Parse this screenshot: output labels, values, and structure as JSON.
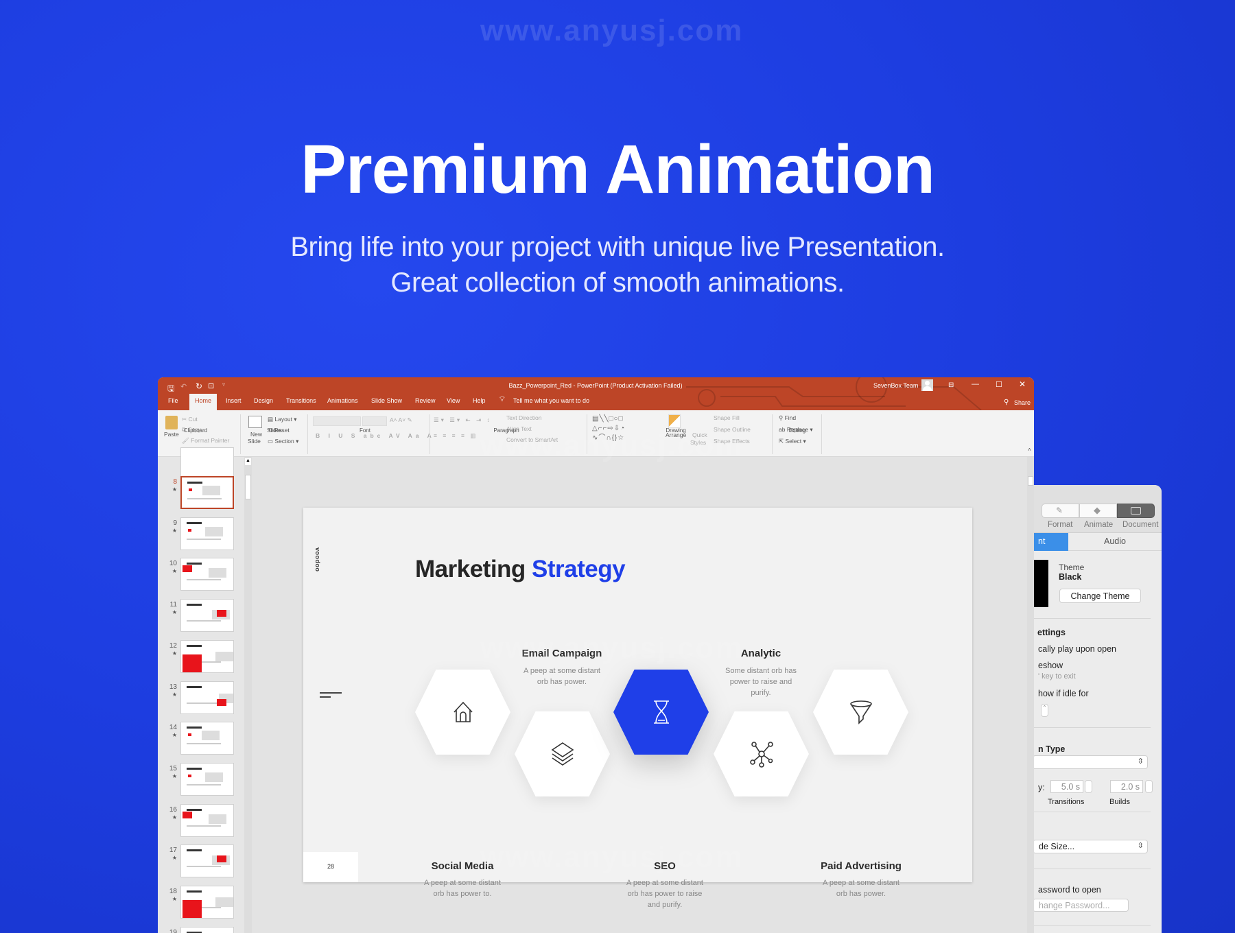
{
  "hero": {
    "title": "Premium Animation",
    "subtitle_line1": "Bring life into your project with unique live Presentation.",
    "subtitle_line2": "Great collection of smooth animations."
  },
  "watermark": "www.anyusj.com",
  "colors": {
    "background": "#1f40e6",
    "titlebar": "#bd4527",
    "accent_blue": "#1f3fe8",
    "thumb_accent": "#e8141b"
  },
  "window": {
    "title": "Bazz_Powerpoint_Red  -  PowerPoint (Product Activation Failed)",
    "user": "SevenBox Team",
    "share": "Share",
    "tabs": [
      "File",
      "Home",
      "Insert",
      "Design",
      "Transitions",
      "Animations",
      "Slide Show",
      "Review",
      "View",
      "Help"
    ],
    "active_tab": "Home",
    "tell_me": "Tell me what you want to do"
  },
  "ribbon": {
    "clipboard": {
      "paste": "Paste",
      "cut": "Cut",
      "copy": "Copy",
      "format_painter": "Format Painter",
      "group": "Clipboard"
    },
    "slides": {
      "new_slide_1": "New",
      "new_slide_2": "Slide",
      "layout": "Layout",
      "reset": "Reset",
      "section": "Section",
      "group": "Slides"
    },
    "font": {
      "group": "Font"
    },
    "paragraph": {
      "text_direction": "Text Direction",
      "align_text": "Align Text",
      "convert": "Convert to SmartArt",
      "group": "Paragraph"
    },
    "drawing": {
      "arrange": "Arrange",
      "quick_styles_1": "Quick",
      "quick_styles_2": "Styles",
      "shape_fill": "Shape Fill",
      "shape_outline": "Shape Outline",
      "shape_effects": "Shape Effects",
      "group": "Drawing"
    },
    "editing": {
      "find": "Find",
      "replace": "Replace",
      "select": "Select",
      "group": "Editing"
    }
  },
  "thumbnails": {
    "numbers": [
      "8",
      "9",
      "10",
      "11",
      "12",
      "13",
      "14",
      "15",
      "16",
      "17",
      "18",
      "19"
    ],
    "selected": "8"
  },
  "slide": {
    "brand": "voodoo",
    "title_dark": "Marketing",
    "title_blue": "Strategy",
    "page_number": "28",
    "items": [
      {
        "title": "Social Media",
        "desc": [
          "A peep at some distant",
          "orb has power to."
        ],
        "icon": "house-icon"
      },
      {
        "title": "Email Campaign",
        "desc": [
          "A peep at some distant",
          "orb has power."
        ],
        "icon": "layers-icon"
      },
      {
        "title": "SEO",
        "desc": [
          "A peep at some distant",
          "orb has power to raise",
          "and purify."
        ],
        "icon": "hourglass-icon"
      },
      {
        "title": "Analytic",
        "desc": [
          "Some distant orb has",
          "power to raise and",
          "purify."
        ],
        "icon": "network-icon"
      },
      {
        "title": "Paid Advertising",
        "desc": [
          "A peep at some distant",
          "orb has power."
        ],
        "icon": "funnel-icon"
      }
    ]
  },
  "inspector": {
    "tabs": [
      "Format",
      "Animate",
      "Document"
    ],
    "active_tab": "Document",
    "subtab_left": "nt",
    "subtab_right": "Audio",
    "theme_label": "Theme",
    "theme_value": "Black",
    "change_theme": "Change Theme",
    "settings": "ettings",
    "autoplay": "cally play upon open",
    "slideshow": "eshow",
    "key_exit": "' key to exit",
    "idle": "how if idle for",
    "type": "n Type",
    "delay_prefix": "y:",
    "transitions_value": "5.0 s",
    "builds_value": "2.0 s",
    "transitions": "Transitions",
    "builds": "Builds",
    "slide_size": "de Size...",
    "password": "assword to open",
    "change_password": "hange Password..."
  }
}
